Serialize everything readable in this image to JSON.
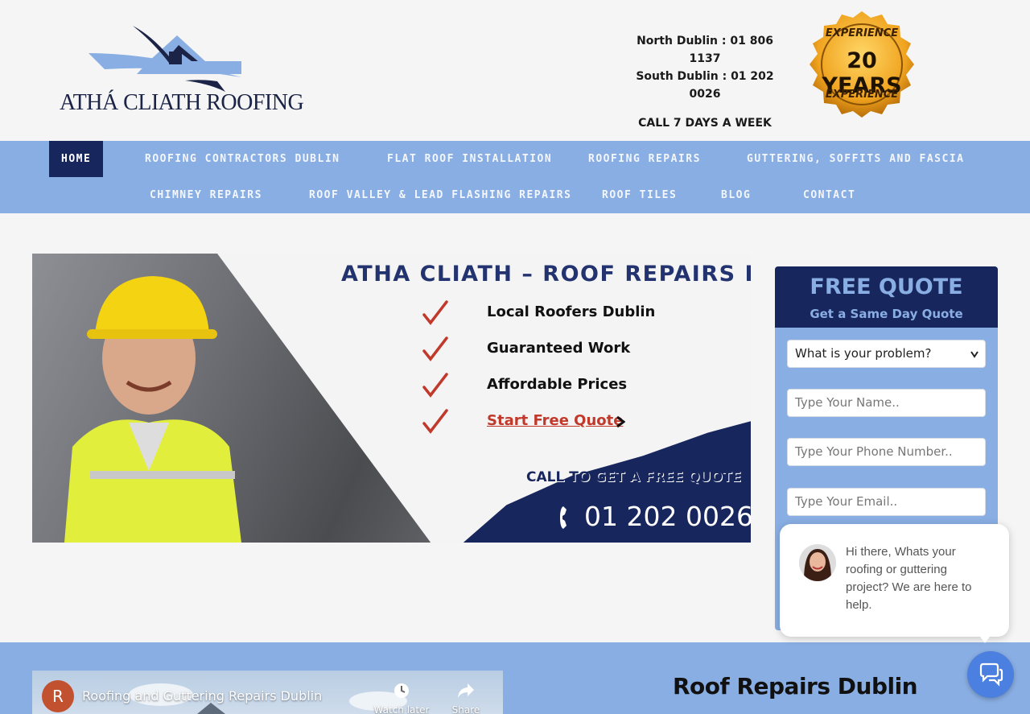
{
  "header": {
    "logo_text": "ATHÁ CLIATH ROOFING",
    "north_dublin": "North Dublin : 01 806 1137",
    "south_dublin": "South Dublin : 01 202 0026",
    "call_days": "CALL 7 DAYS A WEEK",
    "badge_top": "EXPERIENCE",
    "badge_years": "20 YEARS",
    "badge_bottom": "EXPERIENCE"
  },
  "nav": {
    "row1": [
      "HOME",
      "ROOFING CONTRACTORS DUBLIN",
      "FLAT ROOF INSTALLATION",
      "ROOFING REPAIRS",
      "GUTTERING, SOFFITS AND FASCIA"
    ],
    "row2": [
      "CHIMNEY REPAIRS",
      "ROOF VALLEY & LEAD FLASHING REPAIRS",
      "ROOF TILES",
      "BLOG",
      "CONTACT"
    ],
    "active": "HOME"
  },
  "hero": {
    "title": "ATHA CLIATH – ROOF REPAIRS DUBLIN",
    "bullets": [
      "Local Roofers Dublin",
      "Guaranteed Work",
      "Affordable Prices"
    ],
    "cta_link": "Start Free Quote",
    "call_text": "CALL TO GET A FREE QUOTE",
    "phone": "01 202 0026"
  },
  "quote": {
    "title": "FREE QUOTE",
    "subtitle": "Get a Same Day Quote",
    "select_value": "What is your problem?",
    "name_placeholder": "Type Your Name..",
    "phone_placeholder": "Type Your Phone Number..",
    "email_placeholder": "Type Your Email.."
  },
  "chat": {
    "message": "Hi there, Whats your roofing or guttering project? We are here to help."
  },
  "video": {
    "avatar_letter": "R",
    "title": "Roofing and Guttering Repairs Dublin",
    "watch_later": "Watch later",
    "share": "Share"
  },
  "section": {
    "heading": "Roof Repairs Dublin"
  },
  "colors": {
    "navy": "#18265e",
    "light_blue": "#89aee3",
    "accent_red": "#c0392b",
    "chat_blue": "#4b7fe0"
  }
}
